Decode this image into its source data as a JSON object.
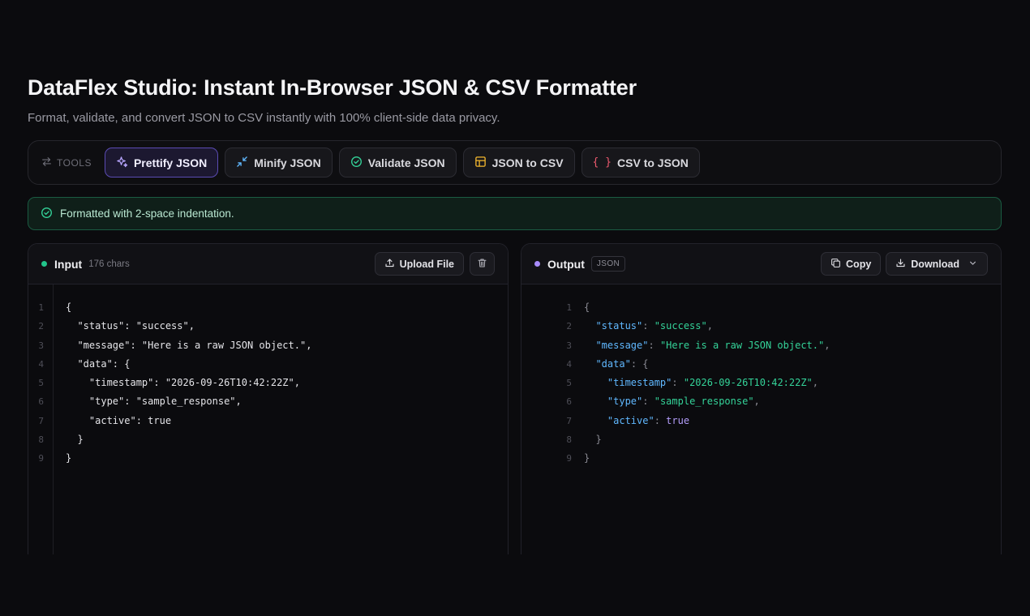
{
  "header": {
    "title": "DataFlex Studio: Instant In-Browser JSON & CSV Formatter",
    "subtitle": "Format, validate, and convert JSON to CSV instantly with 100% client-side data privacy."
  },
  "toolbar": {
    "label": "TOOLS",
    "buttons": [
      {
        "label": "Prettify JSON",
        "icon": "sparkle-icon",
        "active": true
      },
      {
        "label": "Minify JSON",
        "icon": "minimize-icon",
        "active": false
      },
      {
        "label": "Validate JSON",
        "icon": "check-circle-icon",
        "active": false
      },
      {
        "label": "JSON to CSV",
        "icon": "table-icon",
        "active": false
      },
      {
        "label": "CSV to JSON",
        "icon": "braces-icon",
        "active": false
      }
    ]
  },
  "status": {
    "message": "Formatted with 2-space indentation.",
    "icon": "check-circle-icon",
    "color": "#34d399"
  },
  "input_panel": {
    "title": "Input",
    "char_count": "176 chars",
    "upload_label": "Upload File",
    "line_numbers": [
      "1",
      "2",
      "3",
      "4",
      "5",
      "6",
      "7",
      "8",
      "9"
    ],
    "lines": [
      "{",
      "  \"status\": \"success\",",
      "  \"message\": \"Here is a raw JSON object.\",",
      "  \"data\": {",
      "    \"timestamp\": \"2026-09-26T10:42:22Z\",",
      "    \"type\": \"sample_response\",",
      "    \"active\": true",
      "  }",
      "}"
    ]
  },
  "output_panel": {
    "title": "Output",
    "format_badge": "JSON",
    "copy_label": "Copy",
    "download_label": "Download",
    "line_numbers": [
      "1",
      "2",
      "3",
      "4",
      "5",
      "6",
      "7",
      "8",
      "9"
    ],
    "lines": [
      [
        {
          "t": "p",
          "v": "{"
        }
      ],
      [
        {
          "t": "p",
          "v": "  "
        },
        {
          "t": "k",
          "v": "\"status\""
        },
        {
          "t": "p",
          "v": ": "
        },
        {
          "t": "s",
          "v": "\"success\""
        },
        {
          "t": "p",
          "v": ","
        }
      ],
      [
        {
          "t": "p",
          "v": "  "
        },
        {
          "t": "k",
          "v": "\"message\""
        },
        {
          "t": "p",
          "v": ": "
        },
        {
          "t": "s",
          "v": "\"Here is a raw JSON object.\""
        },
        {
          "t": "p",
          "v": ","
        }
      ],
      [
        {
          "t": "p",
          "v": "  "
        },
        {
          "t": "k",
          "v": "\"data\""
        },
        {
          "t": "p",
          "v": ": {"
        }
      ],
      [
        {
          "t": "p",
          "v": "    "
        },
        {
          "t": "k",
          "v": "\"timestamp\""
        },
        {
          "t": "p",
          "v": ": "
        },
        {
          "t": "s",
          "v": "\"2026-09-26T10:42:22Z\""
        },
        {
          "t": "p",
          "v": ","
        }
      ],
      [
        {
          "t": "p",
          "v": "    "
        },
        {
          "t": "k",
          "v": "\"type\""
        },
        {
          "t": "p",
          "v": ": "
        },
        {
          "t": "s",
          "v": "\"sample_response\""
        },
        {
          "t": "p",
          "v": ","
        }
      ],
      [
        {
          "t": "p",
          "v": "    "
        },
        {
          "t": "k",
          "v": "\"active\""
        },
        {
          "t": "p",
          "v": ": "
        },
        {
          "t": "b",
          "v": "true"
        }
      ],
      [
        {
          "t": "p",
          "v": "  }"
        }
      ],
      [
        {
          "t": "p",
          "v": "}"
        }
      ]
    ]
  },
  "colors": {
    "accent": "#5b4bb3",
    "key": "#60b8ff",
    "string": "#34d399",
    "boolean": "#b39dfa",
    "success": "#22c58b"
  }
}
